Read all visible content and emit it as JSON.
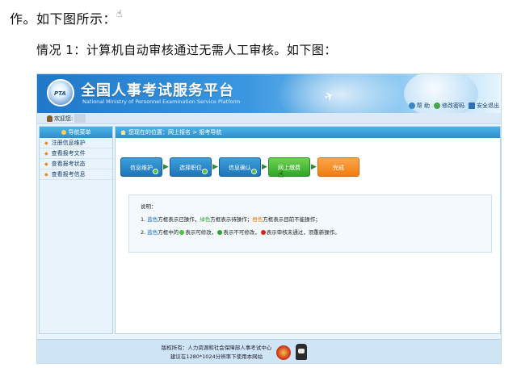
{
  "document": {
    "line1": "作。如下图所示：",
    "line2": "情况 1：计算机自动审核通过无需人工审核。如下图："
  },
  "header": {
    "logo_text": "PTA",
    "title": "全国人事考试服务平台",
    "subtitle": "National Ministry of Personnel Examination Service Platform",
    "links": [
      "帮 助",
      "修改密码",
      "安全退出"
    ]
  },
  "welcome": {
    "label": "欢迎您:"
  },
  "sidebar": {
    "title": "导航菜单",
    "items": [
      {
        "label": "注册信息维护"
      },
      {
        "label": "查看报考文件"
      },
      {
        "label": "查看报考状态"
      },
      {
        "label": "查看报考信息"
      }
    ]
  },
  "breadcrumb": {
    "text": "您现在的位置：网上报名 > 报考导航"
  },
  "steps": [
    {
      "label": "信息维护",
      "color": "blue",
      "checked": true
    },
    {
      "label": "选择职位",
      "color": "blue",
      "checked": true
    },
    {
      "label": "信息确认",
      "color": "blue",
      "checked": true
    },
    {
      "label": "网上缴费",
      "color": "green",
      "checked": false
    },
    {
      "label": "完成",
      "color": "orange",
      "checked": false
    }
  ],
  "note": {
    "title": "说明：",
    "l1_prefix": "1.",
    "l1_blue": "蓝色",
    "l1_a": "方框表示已操作，",
    "l1_green": "绿色",
    "l1_b": "方框表示待操作；",
    "l1_orange": "橙色",
    "l1_c": "方框表示目前不能操作；",
    "l2_prefix": "2.",
    "l2_blue": "蓝色",
    "l2_a": "方框中的",
    "l2_b": "表示可修改，",
    "l2_c": "表示不可修改，",
    "l2_d": "表示审核未通过，须重新操作。"
  },
  "footer": {
    "line1": "版权所有：人力资源和社会保障部人事考试中心",
    "line2": "建议在1280*1024分辨率下使用本网站"
  },
  "colors": {
    "blue": "#1f74b8",
    "green": "#2ea52a",
    "orange": "#f07c12",
    "banner": "#1f78c8"
  }
}
